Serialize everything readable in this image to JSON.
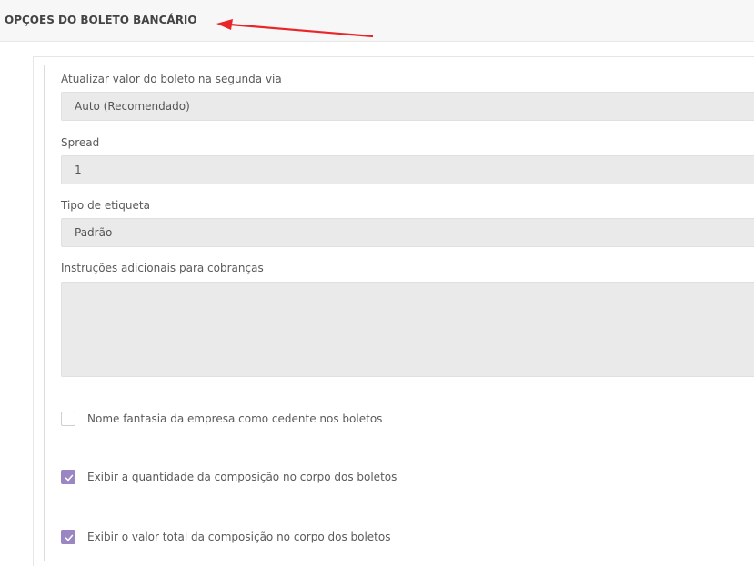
{
  "section": {
    "title": "OPÇOES DO BOLETO BANCÁRIO"
  },
  "annotation": {
    "color": "#e8262a",
    "icon": "red-arrow-icon"
  },
  "fields": {
    "atualizar": {
      "label": "Atualizar valor do boleto na segunda via",
      "value": "Auto (Recomendado)"
    },
    "spread": {
      "label": "Spread",
      "value": "1"
    },
    "etiqueta": {
      "label": "Tipo de etiqueta",
      "value": "Padrão"
    },
    "instrucoes": {
      "label": "Instruções adicionais para cobranças",
      "value": ""
    }
  },
  "options": [
    {
      "label": "Nome fantasia da empresa como cedente nos boletos",
      "checked": false
    },
    {
      "label": "Exibir a quantidade da composição no corpo dos boletos",
      "checked": true
    },
    {
      "label": "Exibir o valor total da composição no corpo dos boletos",
      "checked": true
    }
  ],
  "colors": {
    "checkbox_checked": "#9a86c2",
    "field_background": "#eaeaea",
    "header_background": "#f7f7f7"
  }
}
